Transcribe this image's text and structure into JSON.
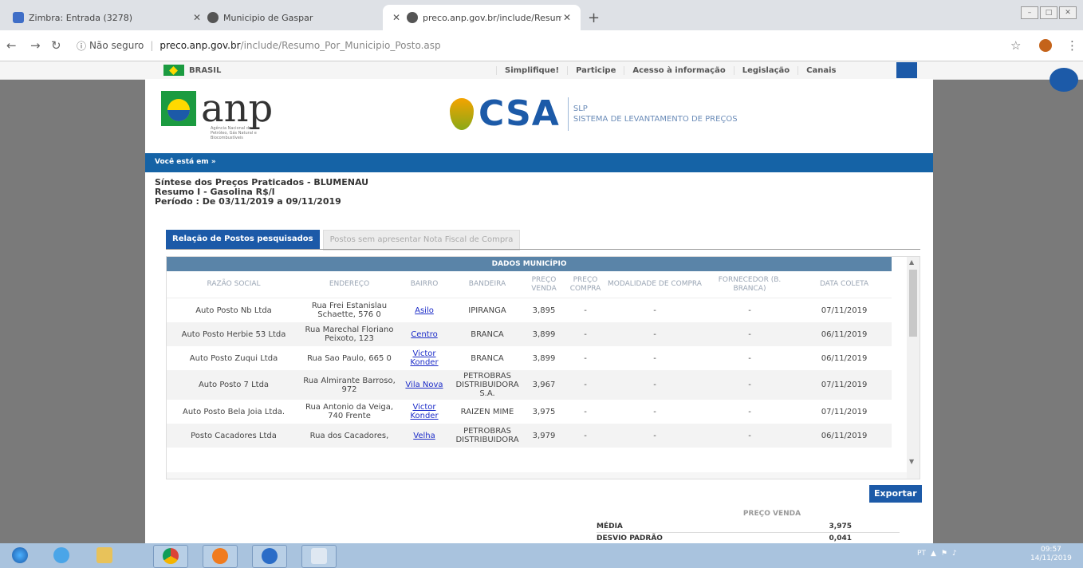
{
  "browser": {
    "tabs": [
      {
        "label": "Zimbra: Entrada (3278)",
        "color": "#3f6ec7"
      },
      {
        "label": "Municipio de Gaspar",
        "color": "#555555"
      },
      {
        "label": "preco.anp.gov.br/include/Resum",
        "color": "#555555"
      }
    ],
    "url_security": "Não seguro",
    "url_host": "preco.anp.gov.br",
    "url_path": "/include/Resumo_Por_Municipio_Posto.asp"
  },
  "govbar": {
    "country": "BRASIL",
    "links": [
      "Simplifique!",
      "Participe",
      "Acesso à informação",
      "Legislação",
      "Canais"
    ]
  },
  "header": {
    "logo_text": "anp",
    "logo_sub": "Agência Nacional do Petróleo, Gás Natural e Biocombustíveis",
    "csa": "CSA",
    "csa_line1": "SLP",
    "csa_line2": "SISTEMA DE LEVANTAMENTO DE PREÇOS"
  },
  "breadcrumb": "Você está em »",
  "title": {
    "line1": "Síntese dos Preços Praticados - BLUMENAU",
    "line2": "Resumo I - Gasolina R$/l",
    "line3": "Período : De 03/11/2019 a 09/11/2019"
  },
  "tabs": {
    "active": "Relação de Postos pesquisados",
    "inactive": "Postos sem apresentar Nota Fiscal de Compra"
  },
  "table": {
    "band": "DADOS MUNICÍPIO",
    "columns": [
      "RAZÃO SOCIAL",
      "ENDEREÇO",
      "BAIRRO",
      "BANDEIRA",
      "PREÇO VENDA",
      "PREÇO COMPRA",
      "MODALIDADE DE COMPRA",
      "FORNECEDOR (B. BRANCA)",
      "DATA COLETA"
    ],
    "rows": [
      [
        "Auto Posto Nb Ltda",
        "Rua Frei Estanislau Schaette, 576 0",
        "Asilo",
        "IPIRANGA",
        "3,895",
        "-",
        "-",
        "-",
        "07/11/2019"
      ],
      [
        "Auto Posto Herbie 53 Ltda",
        "Rua Marechal Floriano Peixoto, 123",
        "Centro",
        "BRANCA",
        "3,899",
        "-",
        "-",
        "-",
        "06/11/2019"
      ],
      [
        "Auto Posto Zuqui Ltda",
        "Rua Sao Paulo, 665 0",
        "Victor Konder",
        "BRANCA",
        "3,899",
        "-",
        "-",
        "-",
        "06/11/2019"
      ],
      [
        "Auto Posto 7 Ltda",
        "Rua Almirante Barroso, 972",
        "Vila Nova",
        "PETROBRAS DISTRIBUIDORA S.A.",
        "3,967",
        "-",
        "-",
        "-",
        "07/11/2019"
      ],
      [
        "Auto Posto Bela Joia Ltda.",
        "Rua Antonio da Veiga, 740 Frente",
        "Victor Konder",
        "RAIZEN MIME",
        "3,975",
        "-",
        "-",
        "-",
        "07/11/2019"
      ],
      [
        "Posto Cacadores Ltda",
        "Rua dos Cacadores,",
        "Velha",
        "PETROBRAS DISTRIBUIDORA",
        "3,979",
        "-",
        "-",
        "-",
        "06/11/2019"
      ]
    ]
  },
  "export_label": "Exportar",
  "stats": {
    "header": "PREÇO VENDA",
    "rows": [
      {
        "label": "MÉDIA",
        "value": "3,975"
      },
      {
        "label": "DESVIO PADRÃO",
        "value": "0,041"
      }
    ]
  },
  "taskbar": {
    "lang": "PT",
    "time": "09:57",
    "date": "14/11/2019"
  }
}
